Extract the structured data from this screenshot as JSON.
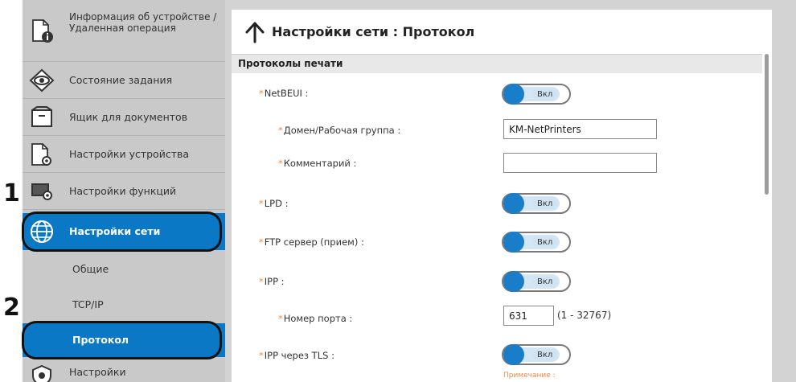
{
  "steps": {
    "one": "1",
    "two": "2"
  },
  "sidebar": {
    "items": [
      {
        "label": "Информация об устройстве / Удаленная операция",
        "icon": "device-info-icon"
      },
      {
        "label": "Состояние задания",
        "icon": "eye-icon"
      },
      {
        "label": "Ящик для документов",
        "icon": "document-box-icon"
      },
      {
        "label": "Настройки устройства",
        "icon": "device-settings-icon"
      },
      {
        "label": "Настройки функций",
        "icon": "function-settings-icon"
      },
      {
        "label": "Настройки сети",
        "icon": "globe-icon"
      },
      {
        "label": "Настройки",
        "icon": "security-icon"
      }
    ],
    "subitems": [
      {
        "label": "Общие"
      },
      {
        "label": "TCP/IP"
      },
      {
        "label": "Протокол"
      }
    ],
    "active_item": "Настройки сети",
    "active_subitem": "Протокол"
  },
  "panel": {
    "title": "Настройки сети : Протокол",
    "section": "Протоколы печати",
    "rows": [
      {
        "label": "NetBEUI :",
        "type": "toggle",
        "value": "Вкл"
      },
      {
        "label": "Домен/Рабочая группа :",
        "type": "text",
        "value": "KM-NetPrinters"
      },
      {
        "label": "Комментарий :",
        "type": "text",
        "value": ""
      },
      {
        "label": "LPD :",
        "type": "toggle",
        "value": "Вкл"
      },
      {
        "label": "FTP сервер (прием) :",
        "type": "toggle",
        "value": "Вкл"
      },
      {
        "label": "IPP :",
        "type": "toggle",
        "value": "Вкл"
      },
      {
        "label": "Номер порта :",
        "type": "port",
        "value": "631",
        "range": "(1 - 32767)"
      },
      {
        "label": "IPP через TLS :",
        "type": "toggle",
        "value": "Вкл"
      }
    ],
    "note": "Примечание :"
  },
  "colors": {
    "accent": "#0b78c6",
    "required_star": "#f08a4b",
    "sidebar_bg": "#c9c9c9"
  }
}
